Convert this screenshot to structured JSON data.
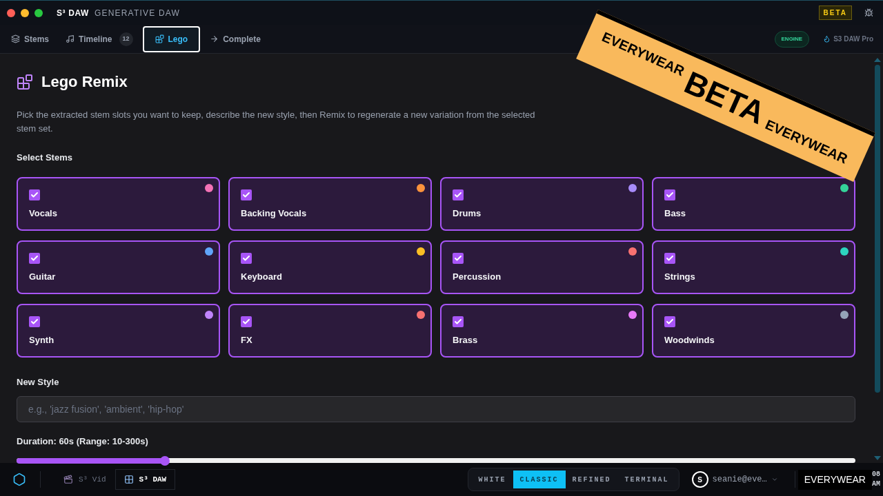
{
  "window": {
    "brand": "S³ DAW",
    "subtitle": "GENERATIVE DAW",
    "badge": "BETA"
  },
  "tabs": [
    {
      "label": "Stems",
      "selected": false
    },
    {
      "label": "Timeline",
      "count": "12",
      "selected": false
    },
    {
      "label": "Lego",
      "selected": true
    },
    {
      "label": "Complete",
      "selected": false
    }
  ],
  "engine_badge": "ENGINE",
  "plan": "S3 DAW Pro",
  "ribbon": {
    "left": "EVERYWEAR",
    "center": "BETA",
    "right": "EVERYWEAR"
  },
  "page": {
    "title": "Lego Remix",
    "description": "Pick the extracted stem slots you want to keep, describe the new style, then Remix to regenerate a new variation from the selected stem set.",
    "stems_label": "Select Stems"
  },
  "stems": [
    {
      "name": "Vocals",
      "checked": true,
      "color": "#f472b6"
    },
    {
      "name": "Backing Vocals",
      "checked": true,
      "color": "#fb923c"
    },
    {
      "name": "Drums",
      "checked": true,
      "color": "#a78bfa"
    },
    {
      "name": "Bass",
      "checked": true,
      "color": "#34d399"
    },
    {
      "name": "Guitar",
      "checked": true,
      "color": "#60a5fa"
    },
    {
      "name": "Keyboard",
      "checked": true,
      "color": "#fbbf24"
    },
    {
      "name": "Percussion",
      "checked": true,
      "color": "#f87171"
    },
    {
      "name": "Strings",
      "checked": true,
      "color": "#2dd4bf"
    },
    {
      "name": "Synth",
      "checked": true,
      "color": "#c084fc"
    },
    {
      "name": "FX",
      "checked": true,
      "color": "#f87171"
    },
    {
      "name": "Brass",
      "checked": true,
      "color": "#e879f9"
    },
    {
      "name": "Woodwinds",
      "checked": true,
      "color": "#94a3b8"
    }
  ],
  "style": {
    "label": "New Style",
    "placeholder": "e.g., 'jazz fusion', 'ambient', 'hip-hop'"
  },
  "duration": {
    "label": "Duration: 60s (Range: 10-300s)",
    "level": 0.177
  },
  "taskbar": {
    "apps": [
      {
        "label": "S³ Vid",
        "selected": false
      },
      {
        "label": "S³ DAW",
        "selected": true
      }
    ],
    "themes": [
      {
        "label": "WHITE",
        "selected": false
      },
      {
        "label": "CLASSIC",
        "selected": true
      },
      {
        "label": "REFINED",
        "selected": false
      },
      {
        "label": "TERMINAL",
        "selected": false
      }
    ],
    "avatar": "S",
    "user": "seanie@eve…",
    "badge": "EVERYWEAR",
    "clock": [
      "08",
      "AM"
    ]
  }
}
